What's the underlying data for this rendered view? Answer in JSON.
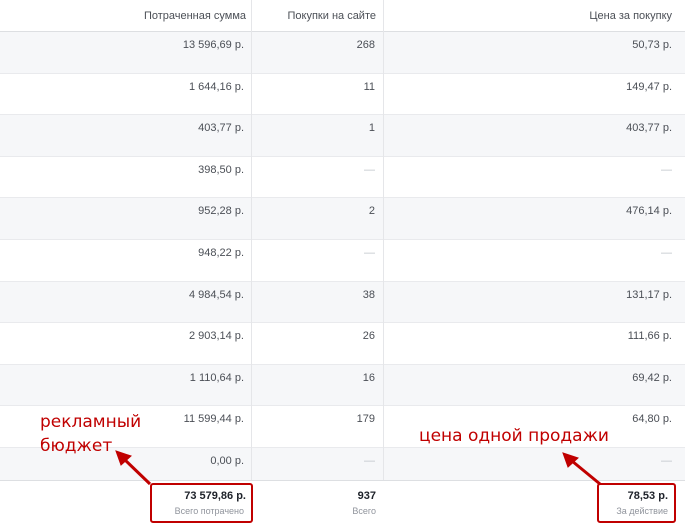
{
  "header": {
    "col_spent": "Потраченная сумма",
    "col_purchases": "Покупки на сайте",
    "col_cost": "Цена за покупку"
  },
  "rows": [
    {
      "spent": "13 596,69 р.",
      "purchases": "268",
      "cost": "50,73 р."
    },
    {
      "spent": "1 644,16 р.",
      "purchases": "11",
      "cost": "149,47 р."
    },
    {
      "spent": "403,77 р.",
      "purchases": "1",
      "cost": "403,77 р."
    },
    {
      "spent": "398,50 р.",
      "purchases": "—",
      "cost": "—"
    },
    {
      "spent": "952,28 р.",
      "purchases": "2",
      "cost": "476,14 р."
    },
    {
      "spent": "948,22 р.",
      "purchases": "—",
      "cost": "—"
    },
    {
      "spent": "4 984,54 р.",
      "purchases": "38",
      "cost": "131,17 р."
    },
    {
      "spent": "2 903,14 р.",
      "purchases": "26",
      "cost": "111,66 р."
    },
    {
      "spent": "1 110,64 р.",
      "purchases": "16",
      "cost": "69,42 р."
    },
    {
      "spent": "11 599,44 р.",
      "purchases": "179",
      "cost": "64,80 р."
    },
    {
      "spent": "0,00 р.",
      "purchases": "—",
      "cost": "—"
    }
  ],
  "totals": {
    "spent": "73 579,86 р.",
    "spent_sub": "Всего потрачено",
    "purchases": "937",
    "purchases_sub": "Всего",
    "cost": "78,53 р.",
    "cost_sub": "За действие"
  },
  "annotations": {
    "budget_line1": "рекламный",
    "budget_line2": "бюджет",
    "sale_price": "цена одной продажи"
  },
  "colors": {
    "annotation_red": "#c00000",
    "alt_row_bg": "#f6f7f9"
  }
}
